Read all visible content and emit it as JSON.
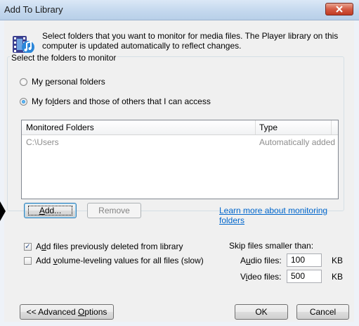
{
  "window": {
    "title": "Add To Library"
  },
  "intro_text": "Select folders that you want to monitor for media files. The Player library on this computer is updated automatically to reflect changes.",
  "group": {
    "label": "Select the folders to monitor",
    "radio_personal": {
      "pre": "My ",
      "mnemonic": "p",
      "post": "ersonal folders",
      "checked": false
    },
    "radio_others": {
      "pre": "My fo",
      "mnemonic": "l",
      "post": "ders and those of others that I can access",
      "checked": true
    }
  },
  "list": {
    "columns": [
      "Monitored Folders",
      "Type"
    ],
    "rows": [
      {
        "folder": "C:\\Users",
        "type": "Automatically added"
      }
    ]
  },
  "buttons": {
    "add": {
      "mnemonic": "A",
      "rest": "dd..."
    },
    "remove": "Remove",
    "advanced": {
      "pre": "<< Advanced ",
      "mnemonic": "O",
      "post": "ptions"
    },
    "ok": "OK",
    "cancel": "Cancel"
  },
  "learn_more_link": "Learn more about monitoring folders",
  "options": {
    "add_deleted": {
      "pre": "A",
      "mnemonic": "d",
      "post": "d files previously deleted from library",
      "checked": true
    },
    "volume_leveling": {
      "pre": "Add ",
      "mnemonic": "v",
      "post": "olume-leveling values for all files (slow)",
      "checked": false
    }
  },
  "skip": {
    "label": "Skip files smaller than:",
    "audio": {
      "pre": "A",
      "mnemonic": "u",
      "post": "dio files:",
      "value": "100",
      "unit": "KB"
    },
    "video": {
      "pre": "V",
      "mnemonic": "i",
      "post": "deo files:",
      "value": "500",
      "unit": "KB"
    }
  },
  "icons": {
    "media": "media-library-icon",
    "close": "close-icon"
  },
  "colors": {
    "link": "#0066cc",
    "close_button": "#d45b44"
  }
}
